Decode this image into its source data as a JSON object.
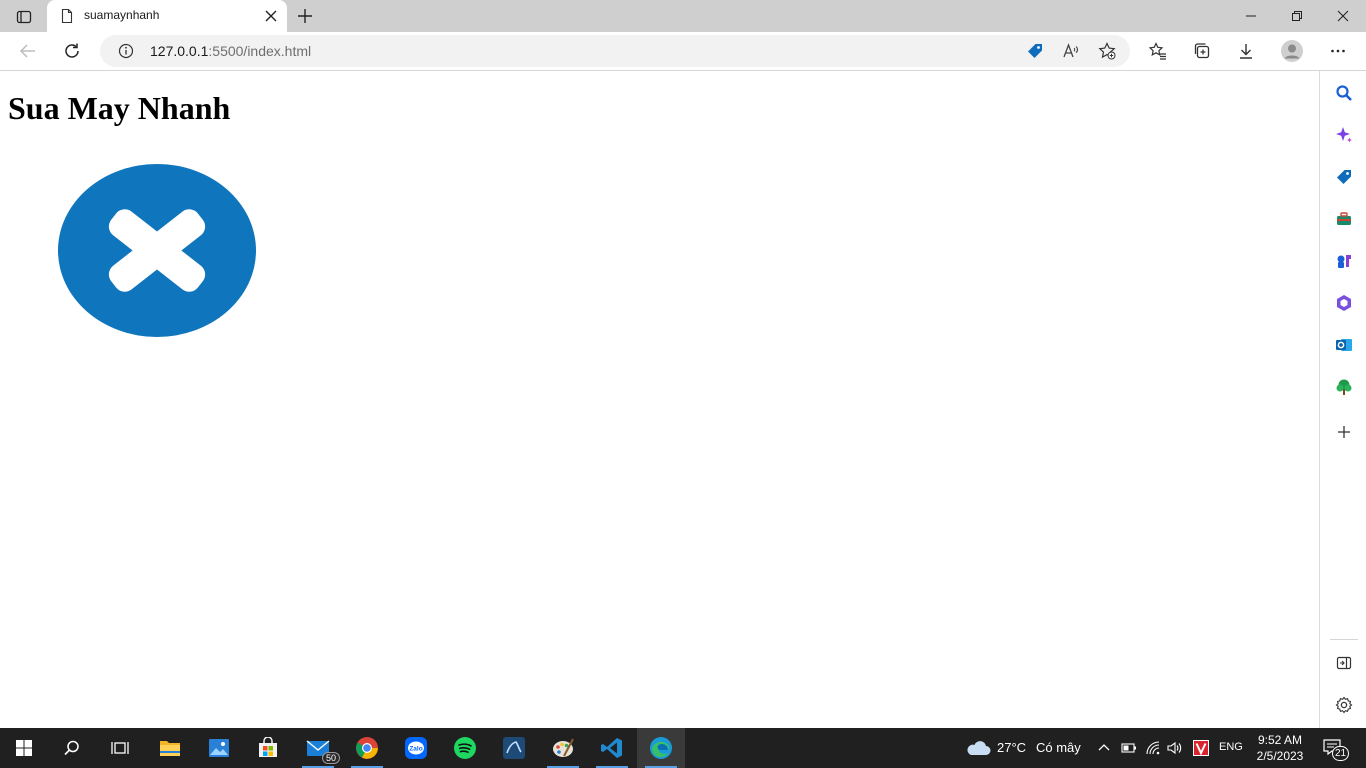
{
  "browser": {
    "tab_title": "suamaynhanh",
    "url_host": "127.0.0.1",
    "url_rest": ":5500/index.html"
  },
  "page": {
    "heading": "Sua May Nhanh",
    "icon": "blue-circle-x-icon",
    "accent_color": "#0f75bc"
  },
  "sidebar": {
    "icons": [
      "search-icon",
      "copilot-icon",
      "shopping-tag-icon",
      "tools-icon",
      "games-icon",
      "office-icon",
      "outlook-icon",
      "tree-icon",
      "add-icon",
      "hide-sidebar-icon",
      "settings-icon"
    ]
  },
  "taskbar": {
    "mail_badge": "50",
    "weather_temp": "27°C",
    "weather_text": "Có mây",
    "lang": "ENG",
    "time": "9:52 AM",
    "date": "2/5/2023",
    "notif_count": "21"
  }
}
